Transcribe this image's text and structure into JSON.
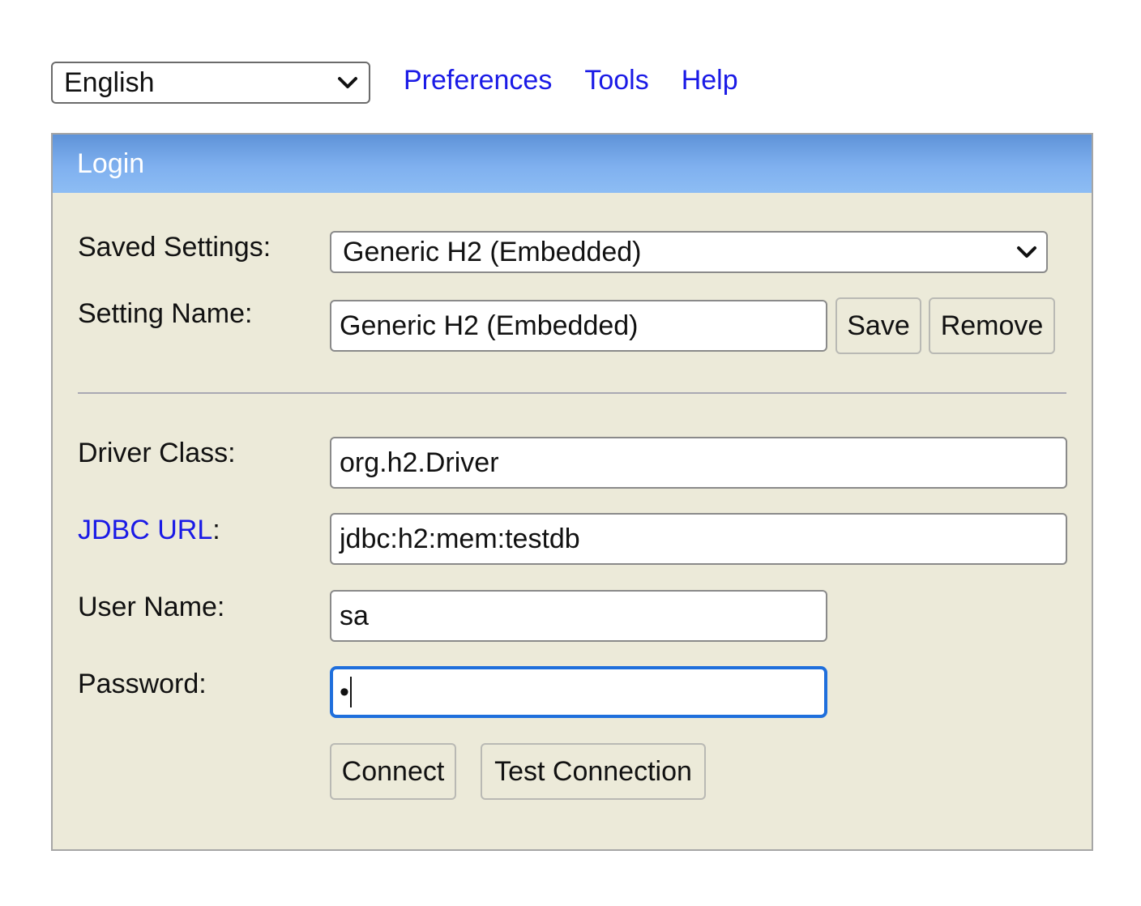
{
  "top": {
    "language": "English",
    "links": [
      "Preferences",
      "Tools",
      "Help"
    ]
  },
  "panel": {
    "title": "Login",
    "saved_settings_label": "Saved Settings:",
    "saved_settings_value": "Generic H2 (Embedded)",
    "setting_name_label": "Setting Name:",
    "setting_name_value": "Generic H2 (Embedded)",
    "save_button": "Save",
    "remove_button": "Remove",
    "driver_class_label": "Driver Class:",
    "driver_class_value": "org.h2.Driver",
    "jdbc_url_link": "JDBC URL",
    "jdbc_url_colon": ":",
    "jdbc_url_value": "jdbc:h2:mem:testdb",
    "user_name_label": "User Name:",
    "user_name_value": "sa",
    "password_label": "Password:",
    "password_value": "•",
    "connect_button": "Connect",
    "test_connection_button": "Test Connection"
  },
  "colors": {
    "header_blue": "#7fb0ef",
    "panel_bg": "#ecead9",
    "link": "#1a1ae6",
    "focus": "#1f6fdc"
  },
  "icons": {
    "dropdown": "chevron-down-icon"
  }
}
